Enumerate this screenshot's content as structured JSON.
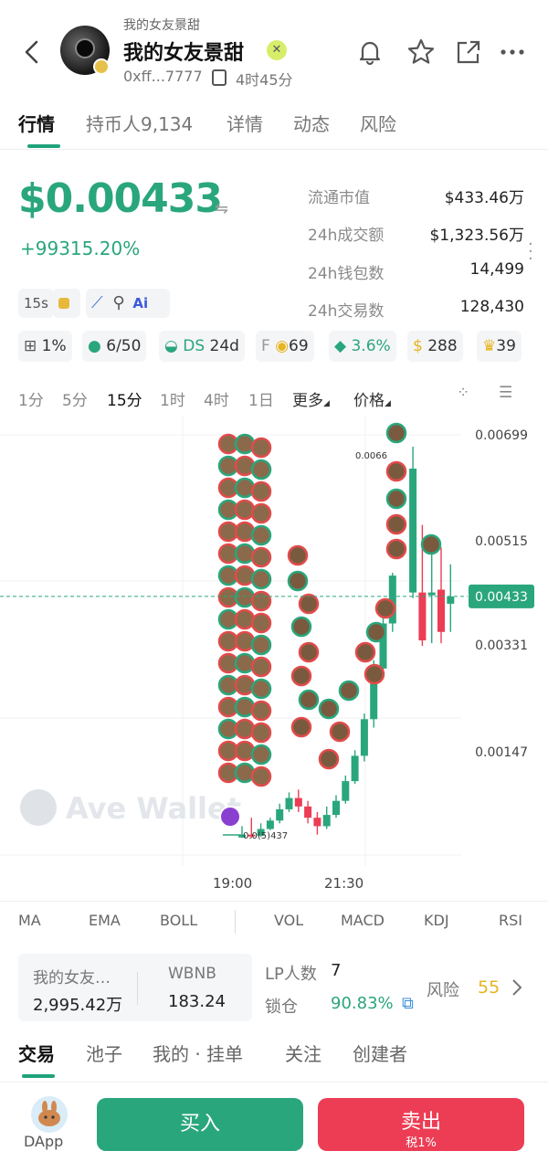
{
  "header": {
    "small_name": "我的女友景甜",
    "name": "我的女友景甜",
    "address": "0xff...7777",
    "age": "4时45分"
  },
  "tabs": [
    "行情",
    "持币人9,134",
    "详情",
    "动态",
    "风险"
  ],
  "price": {
    "value": "$0.00433",
    "change": "+99315.20%"
  },
  "stats": [
    {
      "label": "流通市值",
      "value": "$433.46万"
    },
    {
      "label": "24h成交额",
      "value": "$1,323.56万"
    },
    {
      "label": "24h钱包数",
      "value": "14,499"
    },
    {
      "label": "24h交易数",
      "value": "128,430"
    }
  ],
  "tools": {
    "interval": "15s",
    "ai": "Ai"
  },
  "badges": {
    "tax": "1%",
    "holders": "6/50",
    "ds_prefix": "DS",
    "ds": "24d",
    "f_prefix": "F",
    "f": "69",
    "stack": "3.6%",
    "bag": "288",
    "trophy": "39"
  },
  "timeframes": [
    "1分",
    "5分",
    "15分",
    "1时",
    "4时",
    "1日",
    "更多",
    "价格"
  ],
  "chart_data": {
    "type": "candlestick",
    "y_ticks": [
      "0.00699",
      "0.00515",
      "0.00331",
      "0.00147"
    ],
    "current_price_label": "0.00433",
    "high_label": "0.0066",
    "low_label": "0.0(5)437",
    "x_ticks": [
      "19:00",
      "21:30"
    ],
    "watermark": "Ave Wallet",
    "colors": {
      "up": "#2aa67c",
      "down": "#ec3d54"
    },
    "candles": [
      {
        "o": 5e-05,
        "c": 0.0001,
        "h": 0.00025,
        "l": 4e-05
      },
      {
        "o": 0.0001,
        "c": 8e-05,
        "h": 0.0004,
        "l": 4e-05
      },
      {
        "o": 8e-05,
        "c": 0.0002,
        "h": 0.0003,
        "l": 6e-05
      },
      {
        "o": 0.0002,
        "c": 0.00035,
        "h": 0.0004,
        "l": 0.00018
      },
      {
        "o": 0.00035,
        "c": 0.00055,
        "h": 0.00065,
        "l": 0.0003
      },
      {
        "o": 0.00055,
        "c": 0.00075,
        "h": 0.00085,
        "l": 0.0005
      },
      {
        "o": 0.00075,
        "c": 0.0006,
        "h": 0.0009,
        "l": 0.0005
      },
      {
        "o": 0.0006,
        "c": 0.0004,
        "h": 0.0007,
        "l": 0.0003
      },
      {
        "o": 0.0004,
        "c": 0.00025,
        "h": 0.0005,
        "l": 0.0001
      },
      {
        "o": 0.00025,
        "c": 0.00045,
        "h": 0.0006,
        "l": 0.0002
      },
      {
        "o": 0.00045,
        "c": 0.0007,
        "h": 0.0008,
        "l": 0.0004
      },
      {
        "o": 0.0007,
        "c": 0.00105,
        "h": 0.00115,
        "l": 0.00065
      },
      {
        "o": 0.00105,
        "c": 0.0015,
        "h": 0.0016,
        "l": 0.001
      },
      {
        "o": 0.0015,
        "c": 0.00215,
        "h": 0.00225,
        "l": 0.0014
      },
      {
        "o": 0.00215,
        "c": 0.00305,
        "h": 0.0032,
        "l": 0.002
      },
      {
        "o": 0.00305,
        "c": 0.00385,
        "h": 0.00395,
        "l": 0.00295
      },
      {
        "o": 0.00385,
        "c": 0.0047,
        "h": 0.00475,
        "l": 0.0037
      },
      {
        "o": 0.0044,
        "c": 0.0066,
        "h": 0.00699,
        "l": 0.0043
      },
      {
        "o": 0.0044,
        "c": 0.00355,
        "h": 0.0056,
        "l": 0.00345
      },
      {
        "o": 0.00435,
        "c": 0.0044,
        "h": 0.0054,
        "l": 0.0035
      },
      {
        "o": 0.00445,
        "c": 0.0037,
        "h": 0.0052,
        "l": 0.0035
      },
      {
        "o": 0.0042,
        "c": 0.00433,
        "h": 0.0049,
        "l": 0.0037
      }
    ]
  },
  "indicators": [
    "MA",
    "EMA",
    "BOLL",
    "VOL",
    "MACD",
    "KDJ",
    "RSI"
  ],
  "pool": {
    "token_label": "我的女友…",
    "token_value": "2,995.42万",
    "pair_label": "WBNB",
    "pair_value": "183.24"
  },
  "lp": {
    "count_label": "LP人数",
    "count": "7",
    "lock_label": "锁仓",
    "lock": "90.83%",
    "risk_label": "风险",
    "risk": "55"
  },
  "bottom_tabs": [
    "交易",
    "池子",
    "我的 · 挂单",
    "关注",
    "创建者"
  ],
  "actions": {
    "dapp": "DApp",
    "buy": "买入",
    "sell": "卖出",
    "sell_tax": "税1%"
  }
}
